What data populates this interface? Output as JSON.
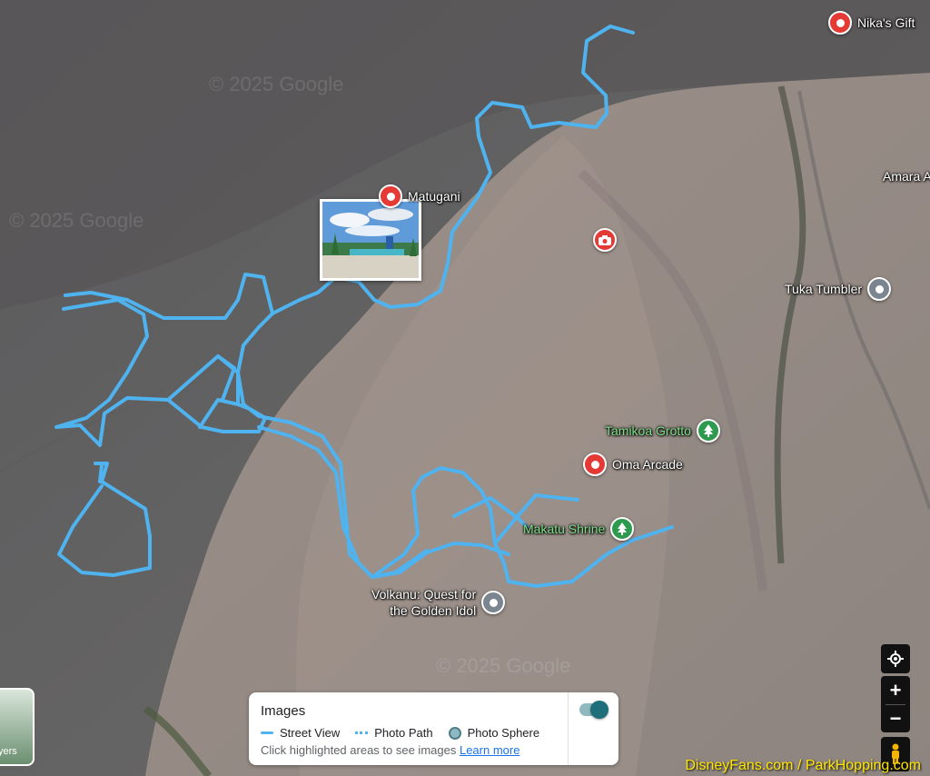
{
  "map": {
    "copyright_marks": [
      "© 2025 Google",
      "© 2025 Google",
      "© 2025 Google"
    ]
  },
  "places": [
    {
      "name": "Nika's Gift",
      "pin": "red-location-pin-icon",
      "color": "#e53935"
    },
    {
      "name": "Matugani",
      "pin": "red-location-pin-icon",
      "color": "#e53935"
    },
    {
      "name": "",
      "pin": "red-camera-pin-icon",
      "color": "#e53935"
    },
    {
      "name": "Amara A",
      "pin": ""
    },
    {
      "name": "Tuka Tumbler",
      "pin": "grey-location-pin-icon",
      "color": "#7a8590"
    },
    {
      "name": "Tamikoa Grotto",
      "pin": "green-tree-pin-icon",
      "color": "#2e9a4e"
    },
    {
      "name": "Oma Arcade",
      "pin": "red-location-pin-icon",
      "color": "#e53935"
    },
    {
      "name": "Makatu Shrine",
      "pin": "green-tree-pin-icon",
      "color": "#2e9a4e"
    },
    {
      "name": "Volkanu: Quest for",
      "name_line2": "the Golden Idol",
      "pin": "grey-location-pin-icon",
      "color": "#7a8590"
    }
  ],
  "street_view": {
    "line_color": "#4fb3f0"
  },
  "legend": {
    "title": "Images",
    "items": [
      {
        "label": "Street View",
        "icon": "street-view-line-icon"
      },
      {
        "label": "Photo Path",
        "icon": "photo-path-dashed-icon"
      },
      {
        "label": "Photo Sphere",
        "icon": "photo-sphere-dot-icon"
      }
    ],
    "hint": "Click highlighted areas to see images",
    "link": "Learn more",
    "toggle_on": true
  },
  "controls": {
    "locate": "my-location-icon",
    "zoom_in": "+",
    "zoom_out": "−",
    "pegman": "pegman-icon"
  },
  "layers": {
    "label": "yers"
  },
  "watermark": "DisneyFans.com / ParkHopping.com"
}
